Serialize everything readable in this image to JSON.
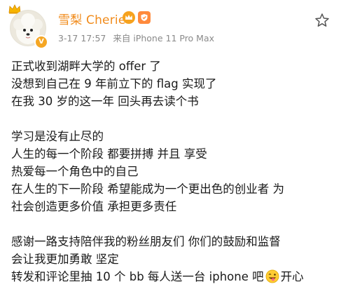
{
  "post": {
    "user": {
      "name": "雪梨 Cherie",
      "verified_badge_icon": "v-verified-icon",
      "badges": [
        "vip-crown-icon",
        "official-shield-icon"
      ]
    },
    "meta": {
      "date": "3-17 17:57",
      "source": "来自 iPhone 11 Pro Max"
    },
    "actions": {
      "favorite_icon": "star-outline-icon"
    },
    "paragraphs": [
      [
        "正式收到湖畔大学的 offer 了",
        "没想到自己在 9 年前立下的 flag 实现了",
        "在我 30 岁的这一年 回头再去读个书"
      ],
      [
        "学习是没有止尽的",
        "人生的每一个阶段 都要拼搏 并且 享受",
        "热爱每一个角色中的自己",
        "在人生的下一阶段 希望能成为一个更出色的创业者 为",
        "社会创造更多价值 承担更多责任"
      ],
      [
        "感谢一路支持陪伴我的粉丝朋友们 你们的鼓励和监督",
        "会让我更加勇敢 坚定"
      ]
    ],
    "last_line": {
      "before_emoji": "转发和评论里抽 10 个 bb 每人送一台 iphone 吧",
      "emoji_icon": "winking-tongue-emoji",
      "after_emoji": "开心"
    }
  },
  "colors": {
    "username": "#f18b1b",
    "meta": "#8a8a8a",
    "text": "#1a1a1a",
    "badge_orange": "#f5a623"
  }
}
